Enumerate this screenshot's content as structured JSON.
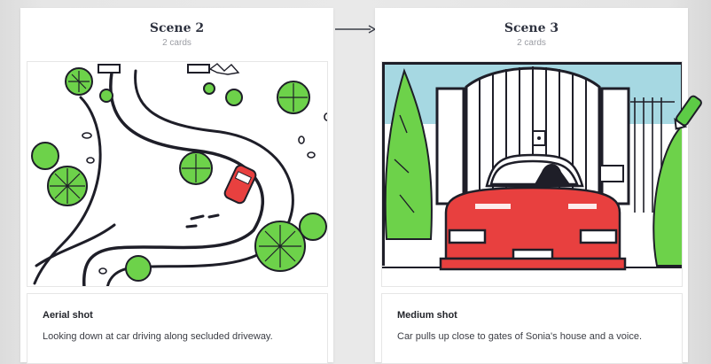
{
  "scenes": [
    {
      "title": "Scene 2",
      "count": "2 cards",
      "card": {
        "shot": "Aerial shot",
        "description": "Looking down at car driving along secluded driveway."
      }
    },
    {
      "title": "Scene 3",
      "count": "2 cards",
      "card": {
        "shot": "Medium shot",
        "description": "Car pulls up close to gates of Sonia's house and a voice."
      }
    }
  ],
  "icons": {
    "connector": "arrow-right-icon",
    "edit": "pencil-icon"
  },
  "colors": {
    "tree_green": "#6dd24a",
    "car_red": "#e8403f",
    "sky_blue": "#a6d8e2",
    "ink": "#1e1e28",
    "pencil_green": "#5dcc46"
  }
}
